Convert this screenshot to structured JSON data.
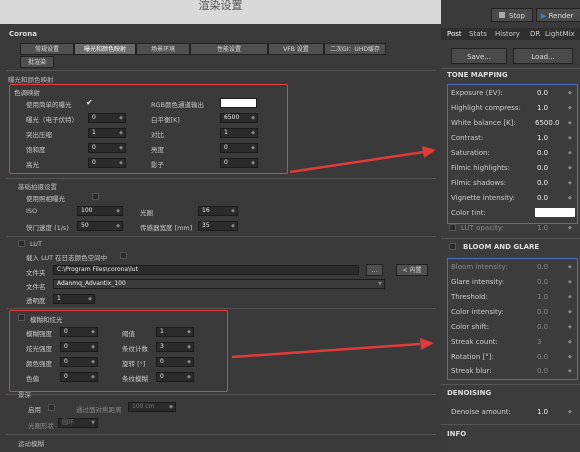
{
  "window_title": "渲染设置",
  "brand": "Corona",
  "tabs": [
    {
      "label": "常规设置"
    },
    {
      "label": "曝光和颜色映射"
    },
    {
      "label": "场景环境"
    },
    {
      "label": "性能设置"
    },
    {
      "label": "VFB 设置"
    },
    {
      "label": "二次GI：UHD缓存"
    },
    {
      "label": "批渲染"
    }
  ],
  "section_exposure": "曝光和颜色映射",
  "tone": {
    "group": "色调映射",
    "simple_exposure_label": "使用简单的曝光",
    "rgb_output_label": "RGB颜色通道输出",
    "exposure_label": "曝光（电子伏特）",
    "exposure_value": "0",
    "white_balance_label": "白平衡[K]",
    "white_balance_value": "6500",
    "highlight_label": "突出压缩",
    "highlight_value": "1",
    "contrast_label": "对比",
    "contrast_value": "1",
    "saturation_label": "饱和度",
    "saturation_value": "0",
    "brightness_label": "亮度",
    "brightness_value": "0",
    "highlights_label": "高光",
    "highlights_value": "0",
    "shadows_label": "影子",
    "shadows_value": "0"
  },
  "camera": {
    "section": "基础拍摄设置",
    "use_photo_exposure": "使用照相曝光",
    "iso_label": "ISO",
    "iso_value": "100",
    "fstop_label": "光圈",
    "fstop_value": "16",
    "shutter_label": "快门速度 (1/s)",
    "shutter_value": "50",
    "sensor_label": "传感器宽度 [mm]",
    "sensor_value": "35"
  },
  "lut": {
    "section": "LUT",
    "enable_label": "载入 LUT 在日志颜色空间中",
    "folder_label": "文件夹",
    "folder_value": "C:\\Program Files\\corona\\lut",
    "browse_label": "...",
    "builtin_label": "< 内置",
    "file_label": "文件名",
    "file_value": "Adanmq_Advantix_100",
    "opacity_label": "透明度",
    "opacity_value": "1"
  },
  "bloom": {
    "section": "模糊和炫光",
    "blur_label": "模糊强度",
    "blur_value": "0",
    "threshold_label": "阈值",
    "threshold_value": "1",
    "glare_label": "炫光强度",
    "glare_value": "0",
    "streak_count_label": "条纹计数",
    "streak_count_value": "3",
    "color_label": "颜色强度",
    "color_value": "0",
    "rotation_label": "旋转 [°]",
    "rotation_value": "0",
    "shift_label": "色偏",
    "shift_value": "0",
    "streak_blur_label": "条纹模糊",
    "streak_blur_value": "0"
  },
  "dof": {
    "section": "景深",
    "enable_label": "启用",
    "focus_label": "通过面对焦距离",
    "focus_value": "100 cm",
    "bokeh_label": "光圈形状",
    "bokeh_value": "圆环"
  },
  "motion_blur": "运动模糊",
  "vfb": {
    "stop_label": "Stop",
    "render_label": "Render",
    "tabs": [
      "Post",
      "Stats",
      "History",
      "DR",
      "LightMix"
    ],
    "save_label": "Save...",
    "load_label": "Load...",
    "tone_mapping_title": "TONE MAPPING",
    "exposure_label": "Exposure (EV):",
    "exposure_value": "0.0",
    "highlight_label": "Highlight compress:",
    "highlight_value": "1.0",
    "wb_label": "White balance [K]:",
    "wb_value": "6500.0",
    "contrast_label": "Contrast:",
    "contrast_value": "1.0",
    "saturation_label": "Saturation:",
    "saturation_value": "0.0",
    "filmic_hi_label": "Filmic highlights:",
    "filmic_hi_value": "0.0",
    "filmic_sh_label": "Filmic shadows:",
    "filmic_sh_value": "0.0",
    "vignette_label": "Vignette intensity:",
    "vignette_value": "0.0",
    "tint_label": "Color tint:",
    "lut_opacity_label": "LUT opacity:",
    "lut_opacity_value": "1.0",
    "bloom_title": "BLOOM AND GLARE",
    "bloom_intensity_label": "Bloom intensity:",
    "bloom_intensity_value": "0.0",
    "glare_intensity_label": "Glare intensity:",
    "glare_intensity_value": "0.0",
    "threshold_label": "Threshold:",
    "threshold_value": "1.0",
    "color_intensity_label": "Color intensity:",
    "color_intensity_value": "0.0",
    "color_shift_label": "Color shift:",
    "color_shift_value": "0.0",
    "streak_count_label": "Streak count:",
    "streak_count_value": "3",
    "rotation_label": "Rotation [°]:",
    "rotation_value": "0.0",
    "streak_blur_label": "Streak blur:",
    "streak_blur_value": "0.0",
    "denoising_title": "DENOISING",
    "denoise_label": "Denoise amount:",
    "denoise_value": "1.0",
    "info_title": "INFO"
  },
  "colors": {
    "highlight_box": "#e04040",
    "blue_box": "#4b6cc8",
    "arrow": "#e03a3a",
    "render_accent": "#3a7bd5"
  }
}
